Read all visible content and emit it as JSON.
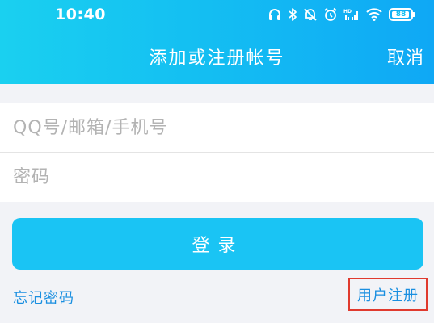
{
  "status_bar": {
    "time": "10:40",
    "icons": [
      "headphones-icon",
      "bluetooth-icon",
      "alarm-off-icon",
      "alarm-icon",
      "hd-signal-icon",
      "wifi-icon",
      "battery-icon"
    ],
    "battery_level": "88"
  },
  "nav": {
    "title": "添加或注册帐号",
    "cancel_label": "取消"
  },
  "form": {
    "account_placeholder": "QQ号/邮箱/手机号",
    "account_value": "",
    "password_placeholder": "密码",
    "password_value": ""
  },
  "login_button_label": "登录",
  "links": {
    "forgot_password": "忘记密码",
    "register": "用户注册"
  },
  "colors": {
    "header_gradient_start": "#1ad0f0",
    "header_gradient_end": "#0fa8f5",
    "button": "#1ac4f4",
    "link": "#1a8fe0",
    "highlight_box": "#e03a2e",
    "background": "#f2f3f7"
  }
}
